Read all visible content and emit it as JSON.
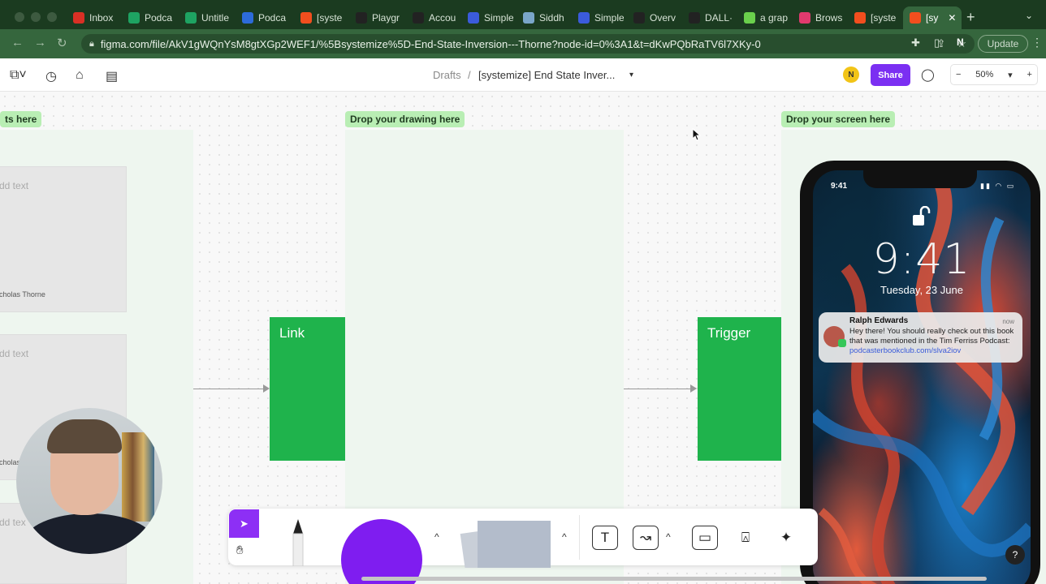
{
  "browser": {
    "tabs": [
      {
        "label": "Inbox",
        "icon": "gmail-icon",
        "color": "#d93025"
      },
      {
        "label": "Podca",
        "icon": "sheets-icon",
        "color": "#1ea362"
      },
      {
        "label": "Untitle",
        "icon": "sheets-icon",
        "color": "#1ea362"
      },
      {
        "label": "Podca",
        "icon": "link-icon",
        "color": "#2d6bd9"
      },
      {
        "label": "[syste",
        "icon": "figma-icon",
        "color": "#f24e1e"
      },
      {
        "label": "Playgr",
        "icon": "openai-icon",
        "color": "#222222"
      },
      {
        "label": "Accou",
        "icon": "openai-icon",
        "color": "#222222"
      },
      {
        "label": "Simple",
        "icon": "doc-icon",
        "color": "#3b5bdb"
      },
      {
        "label": "Siddh",
        "icon": "globe-icon",
        "color": "#7aa6c9"
      },
      {
        "label": "Simple",
        "icon": "doc-icon",
        "color": "#3b5bdb"
      },
      {
        "label": "Overv",
        "icon": "openai-icon",
        "color": "#222222"
      },
      {
        "label": "DALL·",
        "icon": "openai-icon",
        "color": "#222222"
      },
      {
        "label": "a grap",
        "icon": "bar-icon",
        "color": "#6ad04c"
      },
      {
        "label": "Brows",
        "icon": "circle-icon",
        "color": "#e03a6e"
      },
      {
        "label": "[syste",
        "icon": "figma-icon",
        "color": "#f24e1e"
      },
      {
        "label": "[sy",
        "icon": "figma-icon",
        "color": "#f24e1e",
        "active": true
      }
    ],
    "url": "figma.com/file/AkV1gWQnYsM8gtXGp2WEF1/%5Bsystemize%5D-End-State-Inversion---Thorne?node-id=0%3A1&t=dKwPQbRaTV6l7XKy-0",
    "profile_initial": "N",
    "update_label": "Update"
  },
  "figma": {
    "breadcrumb_root": "Drafts",
    "breadcrumb_sep": "/",
    "file_name": "[systemize] End State Inver...",
    "user_initial": "N",
    "share_label": "Share",
    "zoom": "50%"
  },
  "canvas": {
    "labels": {
      "left": "ts here",
      "middle": "Drop your drawing here",
      "right": "Drop your screen here"
    },
    "cards": [
      {
        "placeholder": "dd text",
        "author": "cholas Thorne"
      },
      {
        "placeholder": "dd text",
        "author": "cholas Thorne"
      },
      {
        "placeholder": "dd tex",
        "author": ""
      }
    ],
    "boxes": {
      "link": "Link",
      "trigger": "Trigger"
    }
  },
  "phone": {
    "status_time": "9:41",
    "clock": "9:41",
    "date": "Tuesday, 23 June",
    "notification": {
      "sender": "Ralph Edwards",
      "time": "now",
      "message": "Hey there! You should really check out this book that was mentioned in the Tim Ferriss Podcast: ",
      "link": "podcasterbookclub.com/slva2iov"
    }
  },
  "toolbar": {
    "text_tool": "T",
    "help": "?"
  },
  "colors": {
    "accent": "#7b2ff2",
    "green": "#1fb34c",
    "label_bg": "#b9eeb4"
  }
}
